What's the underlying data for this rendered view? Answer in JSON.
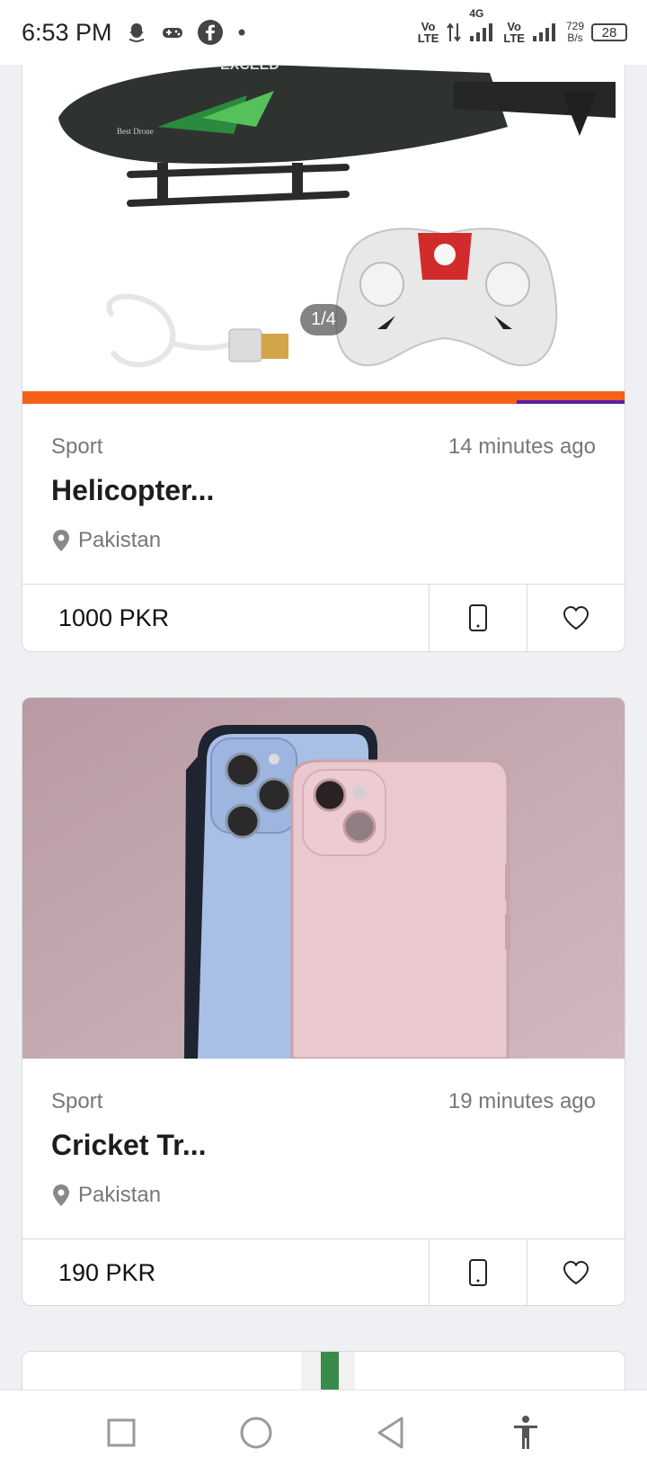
{
  "status_bar": {
    "time": "6:53 PM",
    "volte1": "Vo\nLTE",
    "network": "4G",
    "volte2": "Vo\nLTE",
    "net_speed_value": "729",
    "net_speed_unit": "B/s",
    "battery": "28",
    "icons": [
      "snapchat-icon",
      "game-controller-icon",
      "facebook-icon",
      "dot-icon",
      "data-arrows-icon",
      "signal-icon"
    ]
  },
  "listings": [
    {
      "category": "Sport",
      "time_ago": "14 minutes ago",
      "title": "Helicopter...",
      "location": "Pakistan",
      "price": "1000 PKR",
      "image_counter": "1/4",
      "image_brand_text": "EXCEED",
      "image_brand_text_small": "Best Drone"
    },
    {
      "category": "Sport",
      "time_ago": "19 minutes ago",
      "title": "Cricket Tr...",
      "location": "Pakistan",
      "price": "190 PKR"
    }
  ],
  "colors": {
    "progress": "#f4611a",
    "progress_tail": "#5a1fa8",
    "background": "#eef0f3"
  },
  "nav": {
    "icons": [
      "recent-apps-icon",
      "home-icon",
      "back-icon",
      "accessibility-icon"
    ]
  }
}
